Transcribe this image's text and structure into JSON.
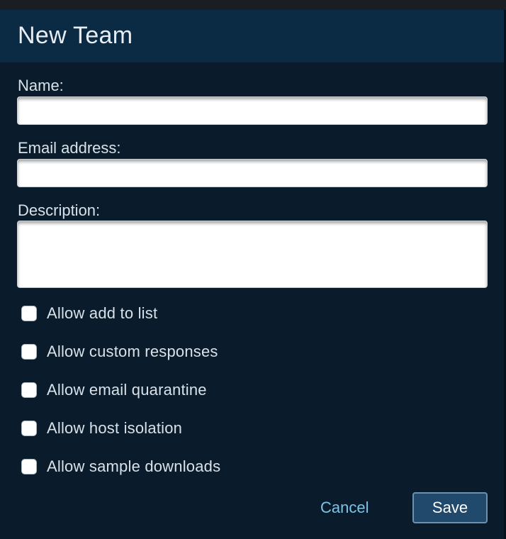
{
  "dialog": {
    "title": "New Team"
  },
  "form": {
    "name": {
      "label": "Name:",
      "value": ""
    },
    "email": {
      "label": "Email address:",
      "value": ""
    },
    "description": {
      "label": "Description:",
      "value": ""
    }
  },
  "options": [
    {
      "label": "Allow add to list",
      "checked": false
    },
    {
      "label": "Allow custom responses",
      "checked": false
    },
    {
      "label": "Allow email quarantine",
      "checked": false
    },
    {
      "label": "Allow host isolation",
      "checked": false
    },
    {
      "label": "Allow sample downloads",
      "checked": false
    }
  ],
  "actions": {
    "cancel_label": "Cancel",
    "save_label": "Save"
  },
  "colors": {
    "header_bg": "#0b2a43",
    "body_bg": "#0a1c2c",
    "link": "#7cc3e6",
    "primary_button": "#21496b"
  }
}
